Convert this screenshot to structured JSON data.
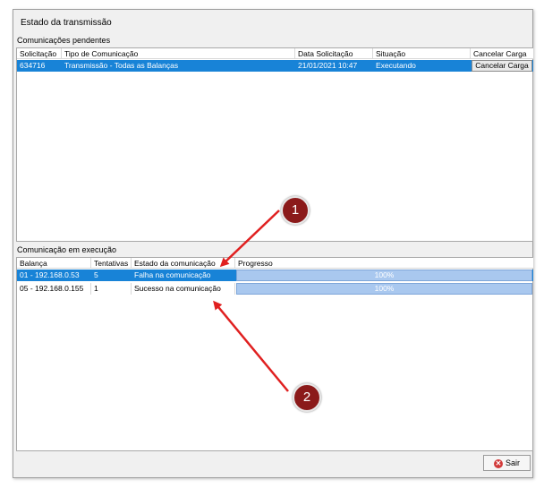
{
  "window": {
    "title": "Estado da transmissão"
  },
  "pending": {
    "label": "Comunicações pendentes",
    "columns": [
      "Solicitação",
      "Tipo de Comunicação",
      "Data Solicitação",
      "Situação",
      "Cancelar Carga"
    ],
    "rows": [
      {
        "solicitacao": "634716",
        "tipo": "Transmissão - Todas as Balanças",
        "data": "21/01/2021 10:47",
        "situacao": "Executando",
        "cancelar": "Cancelar Carga",
        "selected": true
      }
    ]
  },
  "running": {
    "label": "Comunicação em execução",
    "columns": [
      "Balança",
      "Tentativas",
      "Estado da comunicação",
      "Progresso"
    ],
    "rows": [
      {
        "balanca": "01 - 192.168.0.53",
        "tentativas": "5",
        "estado": "Falha na comunicação",
        "progresso": "100%",
        "selected": true
      },
      {
        "balanca": "05 - 192.168.0.155",
        "tentativas": "1",
        "estado": "Sucesso na comunicação",
        "progresso": "100%",
        "selected": false
      }
    ]
  },
  "footer": {
    "exit_label": "Sair"
  },
  "annotations": {
    "badge_1": "1",
    "badge_2": "2",
    "arrow_color": "#e02020",
    "badge_color": "#8b1a1a"
  },
  "colors": {
    "selection": "#1883d7",
    "progress": "#a9c8ef"
  }
}
